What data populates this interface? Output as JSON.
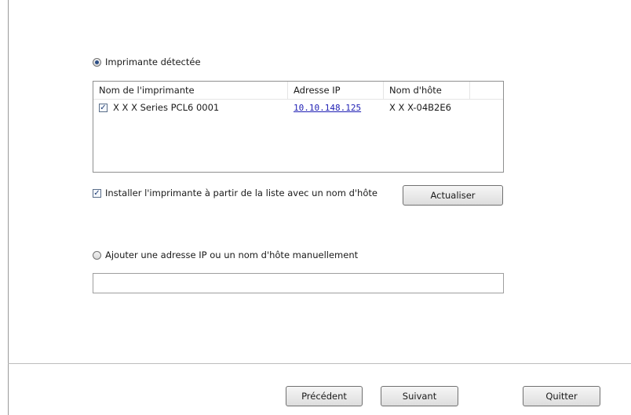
{
  "detected": {
    "radio_label": "Imprimante détectée",
    "selected": true,
    "columns": [
      "Nom de l'imprimante",
      "Adresse IP",
      "Nom d'hôte"
    ],
    "rows": [
      {
        "checked": true,
        "name": "X X X Series PCL6 0001",
        "ip": "10.10.148.125",
        "host": "X X X-04B2E6"
      }
    ]
  },
  "install_option": {
    "label": "Installer l'imprimante à partir de la liste avec un nom d'hôte",
    "checked": true
  },
  "refresh_button": "Actualiser",
  "manual": {
    "radio_label": "Ajouter une adresse IP ou un nom d'hôte manuellement",
    "selected": false,
    "input_value": ""
  },
  "footer": {
    "prev_label": "Précédent",
    "next_label": "Suivant",
    "quit_label": "Quitter"
  },
  "colors": {
    "link": "#1f1fb4",
    "radio_dot": "#2c4e86",
    "check_mark": "#1f3d75"
  }
}
